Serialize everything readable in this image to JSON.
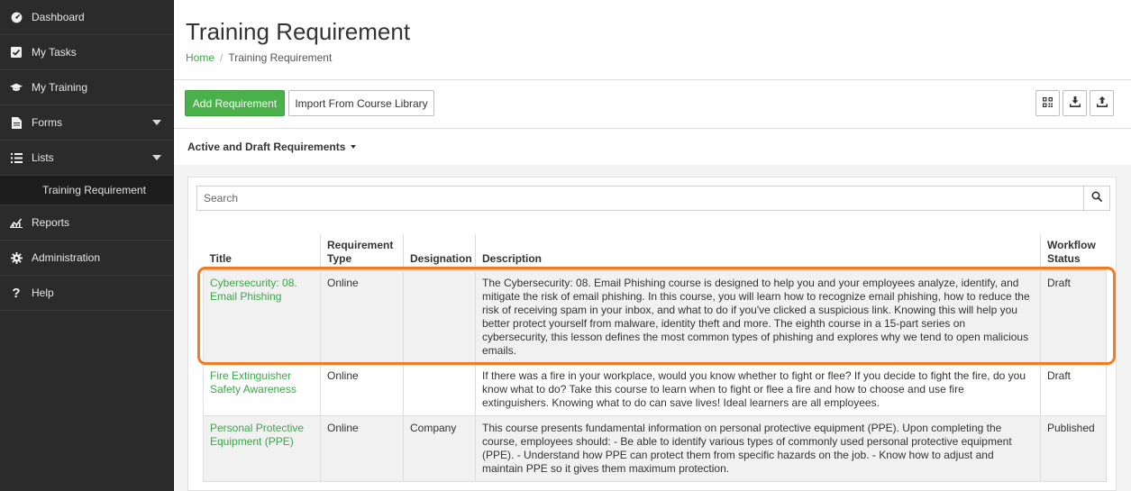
{
  "sidebar": {
    "items": [
      {
        "label": "Dashboard",
        "icon": "dashboard-icon"
      },
      {
        "label": "My Tasks",
        "icon": "checkbox-icon"
      },
      {
        "label": "My Training",
        "icon": "graduation-cap-icon"
      },
      {
        "label": "Forms",
        "icon": "file-icon"
      },
      {
        "label": "Lists",
        "icon": "list-icon"
      },
      {
        "label": "Training Requirement",
        "icon": ""
      },
      {
        "label": "Reports",
        "icon": "chart-icon"
      },
      {
        "label": "Administration",
        "icon": "gear-icon"
      },
      {
        "label": "Help",
        "icon": "question-icon"
      }
    ]
  },
  "header": {
    "title": "Training Requirement",
    "breadcrumb": {
      "home": "Home",
      "separator": "/",
      "current": "Training Requirement"
    }
  },
  "toolbar": {
    "add_label": "Add Requirement",
    "import_label": "Import From Course Library",
    "icons": [
      "qr-code-icon",
      "download-icon",
      "upload-icon"
    ]
  },
  "filter": {
    "label": "Active and Draft Requirements"
  },
  "search": {
    "placeholder": "Search"
  },
  "table": {
    "columns": [
      "Title",
      "Requirement Type",
      "Designation",
      "Description",
      "Workflow Status"
    ],
    "rows": [
      {
        "title": "Cybersecurity: 08. Email Phishing",
        "type": "Online",
        "designation": "",
        "description": "The Cybersecurity: 08. Email Phishing course is designed to help you and your employees analyze, identify, and mitigate the risk of email phishing. In this course, you will learn how to recognize email phishing, how to reduce the risk of receiving spam in your inbox, and what to do if you've clicked a suspicious link. Knowing this will help you better protect yourself from malware, identity theft and more. The eighth course in a 15-part series on cybersecurity, this lesson defines the most common types of phishing and explores why we tend to open malicious emails.",
        "status": "Draft"
      },
      {
        "title": "Fire Extinguisher Safety Awareness",
        "type": "Online",
        "designation": "",
        "description": "If there was a fire in your workplace, would you know whether to fight or flee? If you decide to fight the fire, do you know what to do? Take this course to learn when to fight or flee a fire and how to choose and use fire extinguishers. Knowing what to do can save lives! Ideal learners are all employees.",
        "status": "Draft"
      },
      {
        "title": "Personal Protective Equipment (PPE)",
        "type": "Online",
        "designation": "Company",
        "description": "This course presents fundamental information on personal protective equipment (PPE). Upon completing the course, employees should: - Be able to identify various types of commonly used personal protective equipment (PPE). - Understand how PPE can protect them from specific hazards on the job. - Know how to adjust and maintain PPE so it gives them maximum protection.",
        "status": "Published"
      }
    ]
  },
  "colors": {
    "accent_green": "#4ab04a",
    "link_green": "#3aa646",
    "highlight_orange": "#f47b20",
    "sidebar_bg": "#2b2b2b"
  }
}
